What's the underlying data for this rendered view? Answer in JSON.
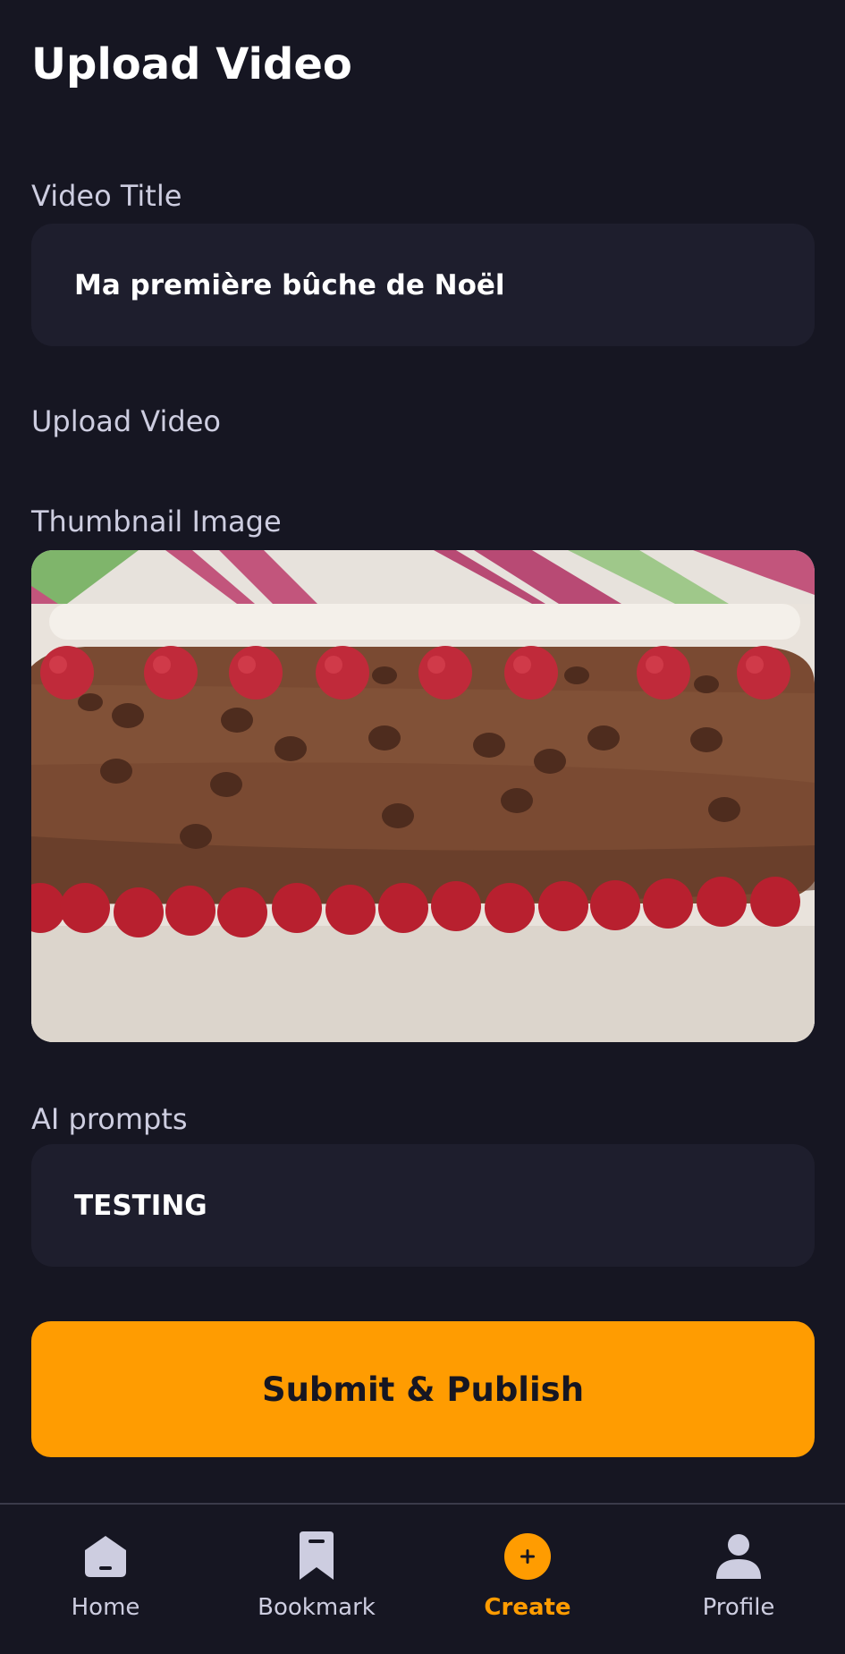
{
  "header": {
    "title": "Upload Video"
  },
  "form": {
    "video_title_label": "Video Title",
    "video_title_value": "Ma première bûche de Noël",
    "upload_video_label": "Upload Video",
    "thumbnail_label": "Thumbnail Image",
    "ai_prompt_label": "AI prompts",
    "ai_prompt_value": "TESTING",
    "submit_label": "Submit & Publish"
  },
  "colors": {
    "background": "#161622",
    "field": "#1e1e2d",
    "accent": "#ff9c01"
  },
  "tabbar": {
    "items": [
      {
        "label": "Home",
        "icon": "home-icon",
        "active": false
      },
      {
        "label": "Bookmark",
        "icon": "bookmark-icon",
        "active": false
      },
      {
        "label": "Create",
        "icon": "plus-circle-icon",
        "active": true
      },
      {
        "label": "Profile",
        "icon": "profile-icon",
        "active": false
      }
    ]
  }
}
